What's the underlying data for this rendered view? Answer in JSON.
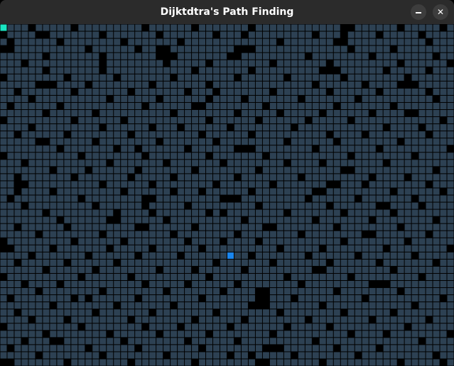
{
  "window": {
    "title": "Dijktdtra's Path Finding",
    "controls": {
      "minimize_icon": "minimize-icon",
      "close_icon": "close-icon",
      "close_glyph": "✕"
    }
  },
  "grid": {
    "columns": 64,
    "rows": 48,
    "colors": {
      "open": "#2d4153",
      "wall": "#000000",
      "line": "#000000",
      "start": "#19e6c2",
      "target": "#1a86ef"
    },
    "start": {
      "col": 0,
      "row": 0
    },
    "target": {
      "col": 32,
      "row": 32
    },
    "walls": [
      [
        4,
        0
      ],
      [
        10,
        0
      ],
      [
        20,
        0
      ],
      [
        27,
        0
      ],
      [
        35,
        0
      ],
      [
        48,
        0
      ],
      [
        49,
        0
      ],
      [
        56,
        0
      ],
      [
        62,
        0
      ],
      [
        0,
        1
      ],
      [
        5,
        1
      ],
      [
        6,
        1
      ],
      [
        14,
        1
      ],
      [
        22,
        1
      ],
      [
        30,
        1
      ],
      [
        34,
        1
      ],
      [
        44,
        1
      ],
      [
        48,
        1
      ],
      [
        53,
        1
      ],
      [
        59,
        1
      ],
      [
        1,
        2
      ],
      [
        8,
        2
      ],
      [
        17,
        2
      ],
      [
        25,
        2
      ],
      [
        39,
        2
      ],
      [
        47,
        2
      ],
      [
        48,
        2
      ],
      [
        60,
        2
      ],
      [
        0,
        3
      ],
      [
        1,
        3
      ],
      [
        12,
        3
      ],
      [
        19,
        3
      ],
      [
        22,
        3
      ],
      [
        23,
        3
      ],
      [
        33,
        3
      ],
      [
        34,
        3
      ],
      [
        35,
        3
      ],
      [
        49,
        3
      ],
      [
        55,
        3
      ],
      [
        6,
        4
      ],
      [
        14,
        4
      ],
      [
        22,
        4
      ],
      [
        23,
        4
      ],
      [
        24,
        4
      ],
      [
        32,
        4
      ],
      [
        33,
        4
      ],
      [
        43,
        4
      ],
      [
        52,
        4
      ],
      [
        61,
        4
      ],
      [
        3,
        5
      ],
      [
        14,
        5
      ],
      [
        23,
        5
      ],
      [
        29,
        5
      ],
      [
        38,
        5
      ],
      [
        46,
        5
      ],
      [
        56,
        5
      ],
      [
        63,
        5
      ],
      [
        6,
        6
      ],
      [
        14,
        6
      ],
      [
        27,
        6
      ],
      [
        35,
        6
      ],
      [
        45,
        6
      ],
      [
        46,
        6
      ],
      [
        47,
        6
      ],
      [
        54,
        6
      ],
      [
        60,
        6
      ],
      [
        0,
        7
      ],
      [
        9,
        7
      ],
      [
        16,
        7
      ],
      [
        24,
        7
      ],
      [
        33,
        7
      ],
      [
        40,
        7
      ],
      [
        48,
        7
      ],
      [
        57,
        7
      ],
      [
        5,
        8
      ],
      [
        6,
        8
      ],
      [
        7,
        8
      ],
      [
        12,
        8
      ],
      [
        21,
        8
      ],
      [
        29,
        8
      ],
      [
        44,
        8
      ],
      [
        51,
        8
      ],
      [
        56,
        8
      ],
      [
        57,
        8
      ],
      [
        58,
        8
      ],
      [
        2,
        9
      ],
      [
        10,
        9
      ],
      [
        18,
        9
      ],
      [
        26,
        9
      ],
      [
        30,
        9
      ],
      [
        38,
        9
      ],
      [
        46,
        9
      ],
      [
        53,
        9
      ],
      [
        60,
        9
      ],
      [
        4,
        10
      ],
      [
        15,
        10
      ],
      [
        22,
        10
      ],
      [
        29,
        10
      ],
      [
        34,
        10
      ],
      [
        42,
        10
      ],
      [
        50,
        10
      ],
      [
        61,
        10
      ],
      [
        1,
        11
      ],
      [
        8,
        11
      ],
      [
        20,
        11
      ],
      [
        27,
        11
      ],
      [
        28,
        11
      ],
      [
        37,
        11
      ],
      [
        47,
        11
      ],
      [
        55,
        11
      ],
      [
        6,
        12
      ],
      [
        13,
        12
      ],
      [
        24,
        12
      ],
      [
        33,
        12
      ],
      [
        39,
        12
      ],
      [
        45,
        12
      ],
      [
        52,
        12
      ],
      [
        57,
        12
      ],
      [
        58,
        12
      ],
      [
        0,
        13
      ],
      [
        10,
        13
      ],
      [
        17,
        13
      ],
      [
        29,
        13
      ],
      [
        36,
        13
      ],
      [
        43,
        13
      ],
      [
        49,
        13
      ],
      [
        62,
        13
      ],
      [
        4,
        14
      ],
      [
        14,
        14
      ],
      [
        21,
        14
      ],
      [
        25,
        14
      ],
      [
        32,
        14
      ],
      [
        41,
        14
      ],
      [
        54,
        14
      ],
      [
        59,
        14
      ],
      [
        2,
        15
      ],
      [
        9,
        15
      ],
      [
        18,
        15
      ],
      [
        28,
        15
      ],
      [
        35,
        15
      ],
      [
        46,
        15
      ],
      [
        51,
        15
      ],
      [
        60,
        15
      ],
      [
        5,
        16
      ],
      [
        6,
        16
      ],
      [
        13,
        16
      ],
      [
        22,
        16
      ],
      [
        30,
        16
      ],
      [
        40,
        16
      ],
      [
        47,
        16
      ],
      [
        56,
        16
      ],
      [
        8,
        17
      ],
      [
        16,
        17
      ],
      [
        19,
        17
      ],
      [
        26,
        17
      ],
      [
        33,
        17
      ],
      [
        34,
        17
      ],
      [
        35,
        17
      ],
      [
        44,
        17
      ],
      [
        53,
        17
      ],
      [
        63,
        17
      ],
      [
        0,
        18
      ],
      [
        11,
        18
      ],
      [
        20,
        18
      ],
      [
        29,
        18
      ],
      [
        37,
        18
      ],
      [
        49,
        18
      ],
      [
        58,
        18
      ],
      [
        3,
        19
      ],
      [
        15,
        19
      ],
      [
        23,
        19
      ],
      [
        31,
        19
      ],
      [
        40,
        19
      ],
      [
        45,
        19
      ],
      [
        54,
        19
      ],
      [
        7,
        20
      ],
      [
        12,
        20
      ],
      [
        19,
        20
      ],
      [
        27,
        20
      ],
      [
        36,
        20
      ],
      [
        48,
        20
      ],
      [
        49,
        20
      ],
      [
        61,
        20
      ],
      [
        2,
        21
      ],
      [
        10,
        21
      ],
      [
        18,
        21
      ],
      [
        24,
        21
      ],
      [
        33,
        21
      ],
      [
        42,
        21
      ],
      [
        52,
        21
      ],
      [
        57,
        21
      ],
      [
        2,
        22
      ],
      [
        3,
        22
      ],
      [
        14,
        22
      ],
      [
        21,
        22
      ],
      [
        30,
        22
      ],
      [
        38,
        22
      ],
      [
        46,
        22
      ],
      [
        47,
        22
      ],
      [
        51,
        22
      ],
      [
        60,
        22
      ],
      [
        2,
        23
      ],
      [
        7,
        23
      ],
      [
        17,
        23
      ],
      [
        24,
        23
      ],
      [
        28,
        23
      ],
      [
        35,
        23
      ],
      [
        44,
        23
      ],
      [
        45,
        23
      ],
      [
        55,
        23
      ],
      [
        62,
        23
      ],
      [
        1,
        24
      ],
      [
        11,
        24
      ],
      [
        20,
        24
      ],
      [
        21,
        24
      ],
      [
        31,
        24
      ],
      [
        32,
        24
      ],
      [
        33,
        24
      ],
      [
        43,
        24
      ],
      [
        50,
        24
      ],
      [
        58,
        24
      ],
      [
        3,
        25
      ],
      [
        13,
        25
      ],
      [
        20,
        25
      ],
      [
        26,
        25
      ],
      [
        36,
        25
      ],
      [
        46,
        25
      ],
      [
        53,
        25
      ],
      [
        54,
        25
      ],
      [
        59,
        25
      ],
      [
        6,
        26
      ],
      [
        16,
        26
      ],
      [
        21,
        26
      ],
      [
        29,
        26
      ],
      [
        31,
        26
      ],
      [
        40,
        26
      ],
      [
        48,
        26
      ],
      [
        55,
        26
      ],
      [
        8,
        27
      ],
      [
        15,
        27
      ],
      [
        16,
        27
      ],
      [
        23,
        27
      ],
      [
        34,
        27
      ],
      [
        44,
        27
      ],
      [
        52,
        27
      ],
      [
        61,
        27
      ],
      [
        2,
        28
      ],
      [
        9,
        28
      ],
      [
        19,
        28
      ],
      [
        20,
        28
      ],
      [
        27,
        28
      ],
      [
        37,
        28
      ],
      [
        38,
        28
      ],
      [
        47,
        28
      ],
      [
        56,
        28
      ],
      [
        5,
        29
      ],
      [
        14,
        29
      ],
      [
        24,
        29
      ],
      [
        33,
        29
      ],
      [
        42,
        29
      ],
      [
        51,
        29
      ],
      [
        52,
        29
      ],
      [
        60,
        29
      ],
      [
        0,
        30
      ],
      [
        10,
        30
      ],
      [
        17,
        30
      ],
      [
        26,
        30
      ],
      [
        31,
        30
      ],
      [
        36,
        30
      ],
      [
        48,
        30
      ],
      [
        57,
        30
      ],
      [
        0,
        31
      ],
      [
        1,
        31
      ],
      [
        7,
        31
      ],
      [
        15,
        31
      ],
      [
        21,
        31
      ],
      [
        28,
        31
      ],
      [
        39,
        31
      ],
      [
        45,
        31
      ],
      [
        54,
        31
      ],
      [
        63,
        31
      ],
      [
        4,
        32
      ],
      [
        12,
        32
      ],
      [
        19,
        32
      ],
      [
        25,
        32
      ],
      [
        35,
        32
      ],
      [
        43,
        32
      ],
      [
        50,
        32
      ],
      [
        58,
        32
      ],
      [
        2,
        33
      ],
      [
        9,
        33
      ],
      [
        16,
        33
      ],
      [
        30,
        33
      ],
      [
        38,
        33
      ],
      [
        46,
        33
      ],
      [
        53,
        33
      ],
      [
        61,
        33
      ],
      [
        6,
        34
      ],
      [
        13,
        34
      ],
      [
        22,
        34
      ],
      [
        27,
        34
      ],
      [
        34,
        34
      ],
      [
        44,
        34
      ],
      [
        45,
        34
      ],
      [
        55,
        34
      ],
      [
        0,
        35
      ],
      [
        11,
        35
      ],
      [
        18,
        35
      ],
      [
        29,
        35
      ],
      [
        40,
        35
      ],
      [
        49,
        35
      ],
      [
        59,
        35
      ],
      [
        3,
        36
      ],
      [
        8,
        36
      ],
      [
        20,
        36
      ],
      [
        26,
        36
      ],
      [
        33,
        36
      ],
      [
        42,
        36
      ],
      [
        52,
        36
      ],
      [
        53,
        36
      ],
      [
        54,
        36
      ],
      [
        5,
        37
      ],
      [
        14,
        37
      ],
      [
        23,
        37
      ],
      [
        31,
        37
      ],
      [
        36,
        37
      ],
      [
        37,
        37
      ],
      [
        47,
        37
      ],
      [
        56,
        37
      ],
      [
        1,
        38
      ],
      [
        10,
        38
      ],
      [
        12,
        38
      ],
      [
        19,
        38
      ],
      [
        28,
        38
      ],
      [
        36,
        38
      ],
      [
        37,
        38
      ],
      [
        41,
        38
      ],
      [
        51,
        38
      ],
      [
        62,
        38
      ],
      [
        7,
        39
      ],
      [
        16,
        39
      ],
      [
        24,
        39
      ],
      [
        35,
        39
      ],
      [
        36,
        39
      ],
      [
        37,
        39
      ],
      [
        45,
        39
      ],
      [
        58,
        39
      ],
      [
        2,
        40
      ],
      [
        13,
        40
      ],
      [
        21,
        40
      ],
      [
        30,
        40
      ],
      [
        39,
        40
      ],
      [
        48,
        40
      ],
      [
        55,
        40
      ],
      [
        4,
        41
      ],
      [
        9,
        41
      ],
      [
        18,
        41
      ],
      [
        27,
        41
      ],
      [
        34,
        41
      ],
      [
        43,
        41
      ],
      [
        52,
        41
      ],
      [
        60,
        41
      ],
      [
        0,
        42
      ],
      [
        11,
        42
      ],
      [
        20,
        42
      ],
      [
        25,
        42
      ],
      [
        32,
        42
      ],
      [
        40,
        42
      ],
      [
        46,
        42
      ],
      [
        57,
        42
      ],
      [
        6,
        43
      ],
      [
        15,
        43
      ],
      [
        22,
        43
      ],
      [
        29,
        43
      ],
      [
        38,
        43
      ],
      [
        49,
        43
      ],
      [
        54,
        43
      ],
      [
        63,
        43
      ],
      [
        3,
        44
      ],
      [
        7,
        44
      ],
      [
        8,
        44
      ],
      [
        17,
        44
      ],
      [
        26,
        44
      ],
      [
        33,
        44
      ],
      [
        44,
        44
      ],
      [
        59,
        44
      ],
      [
        1,
        45
      ],
      [
        12,
        45
      ],
      [
        19,
        45
      ],
      [
        28,
        45
      ],
      [
        37,
        45
      ],
      [
        38,
        45
      ],
      [
        39,
        45
      ],
      [
        47,
        45
      ],
      [
        53,
        45
      ],
      [
        5,
        46
      ],
      [
        14,
        46
      ],
      [
        23,
        46
      ],
      [
        32,
        46
      ],
      [
        35,
        46
      ],
      [
        41,
        46
      ],
      [
        50,
        46
      ],
      [
        61,
        46
      ],
      [
        0,
        47
      ],
      [
        1,
        47
      ],
      [
        9,
        47
      ],
      [
        18,
        47
      ],
      [
        27,
        47
      ],
      [
        36,
        47
      ],
      [
        37,
        47
      ],
      [
        45,
        47
      ],
      [
        56,
        47
      ],
      [
        62,
        47
      ]
    ]
  }
}
